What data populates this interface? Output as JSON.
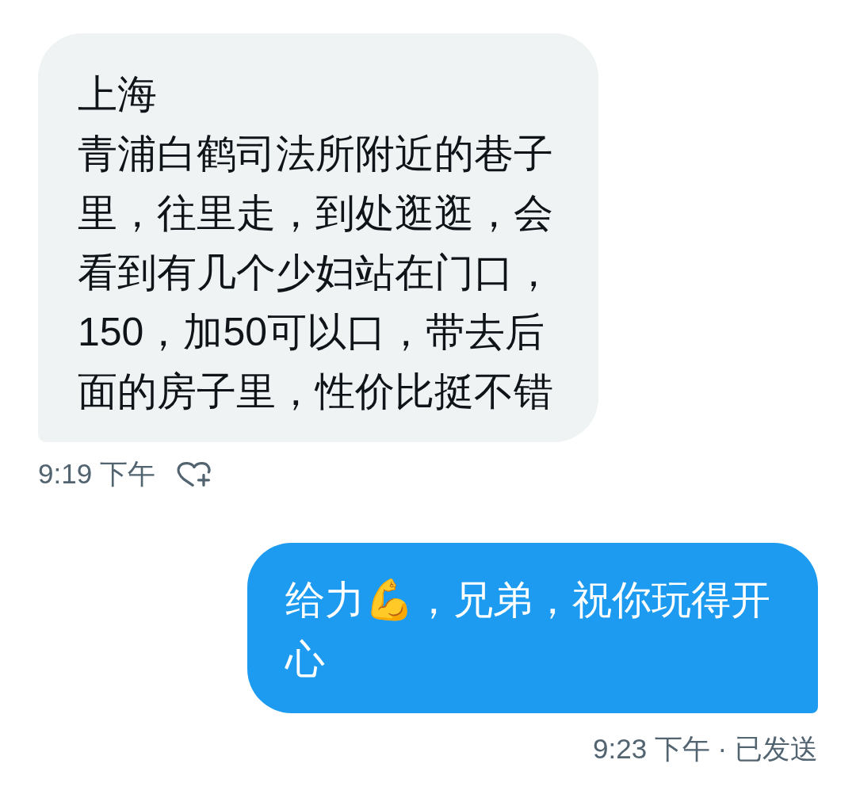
{
  "messages": [
    {
      "kind": "received",
      "paragraphs": [
        "上海",
        "青浦白鹤司法所附近的巷子里，往里走，到处逛逛，会看到有几个少妇站在门口，150，加50可以口，带去后面的房子里，性价比挺不错"
      ],
      "timestamp": "9:19 下午",
      "liked": false
    },
    {
      "kind": "sent",
      "paragraphs": [
        "给力💪，兄弟，祝你玩得开心"
      ],
      "timestamp": "9:23 下午 · 已发送"
    }
  ]
}
